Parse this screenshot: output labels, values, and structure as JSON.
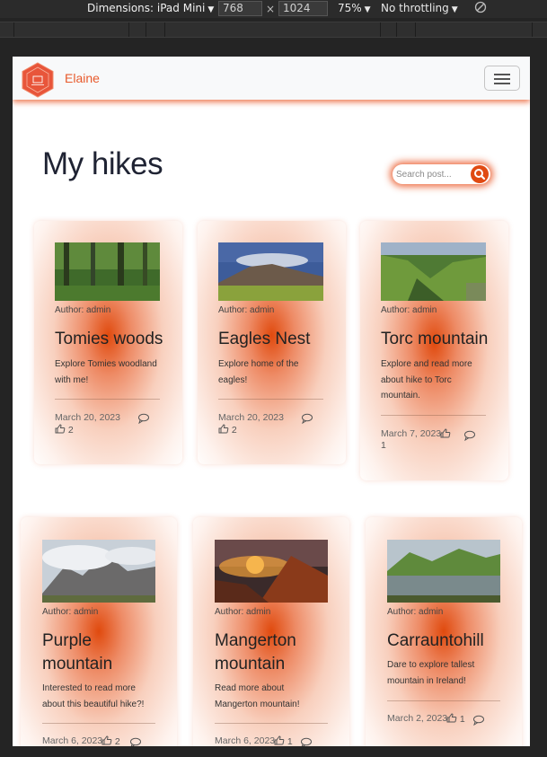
{
  "devtools": {
    "device_label": "Dimensions: iPad Mini",
    "width": "768",
    "height": "1024",
    "times": "×",
    "zoom": "75%",
    "throttling": "No throttling"
  },
  "navbar": {
    "brand": "Elaine",
    "logo_icon": "hexagon-logo-icon",
    "menu_icon": "hamburger-menu-icon"
  },
  "page": {
    "title": "My hikes"
  },
  "search": {
    "placeholder": "Search post..."
  },
  "colors": {
    "accent": "#e85a2c",
    "search_button": "#e04a12",
    "title": "#1f2333"
  },
  "posts": [
    {
      "title": "Tomies woods",
      "author": "Author: admin",
      "description": [
        "Explore Tomies woodland",
        "with me!"
      ],
      "date": "March 20, 2023",
      "likes": "2"
    },
    {
      "title": "Eagles Nest",
      "author": "Author: admin",
      "description": [
        "Explore home of the",
        "eagles!"
      ],
      "date": "March 20, 2023",
      "likes": "2"
    },
    {
      "title": "Torc mountain",
      "author": "Author: admin",
      "description": [
        "Explore and read more",
        "about hike to Torc",
        "mountain."
      ],
      "date": "March 7, 2023",
      "likes": "1"
    },
    {
      "title": [
        "Purple",
        "mountain"
      ],
      "author": "Author: admin",
      "description": [
        "Interested to read more",
        "about this beautiful hike?!"
      ],
      "date": "March 6, 2023",
      "likes": "2"
    },
    {
      "title": [
        "Mangerton",
        "mountain"
      ],
      "author": "Author: admin",
      "description": [
        "Read more about",
        "Mangerton mountain!"
      ],
      "date": "March 6, 2023",
      "likes": "1"
    },
    {
      "title": "Carrauntohill",
      "author": "Author: admin",
      "description": [
        "Dare to explore tallest",
        "mountain in Ireland!"
      ],
      "date": "March 2, 2023",
      "likes": "1"
    }
  ]
}
